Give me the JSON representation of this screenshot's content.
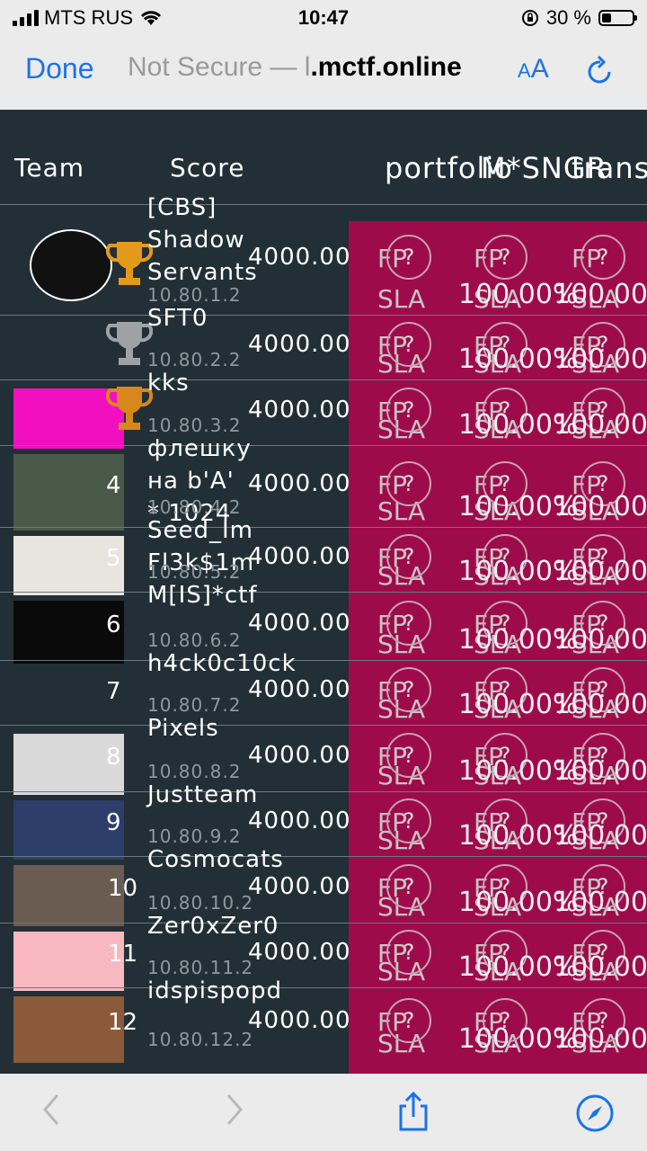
{
  "status": {
    "carrier": "MTS RUS",
    "time": "10:47",
    "battery": "30 %",
    "battery_level": 0.3
  },
  "browser": {
    "done": "Done",
    "not_secure": "Not Secure —",
    "domain_dim": "l",
    "domain": ".mctf.online",
    "text_size": "AA"
  },
  "header": {
    "team": "Team",
    "score": "Score",
    "svc1": "portfolio",
    "svc2": "M*SNGR",
    "svc3": "trans"
  },
  "labels": {
    "sla": "SLA",
    "fp": "FP",
    "pct": "100.00%",
    "q": "?"
  },
  "teams": [
    {
      "rank": "1",
      "name": "[CBS]\nShadow\nServants",
      "ip": "10.80.1.2",
      "score": "4000.00",
      "trophy": "gold",
      "logo": "shadow-servants-logo",
      "logo_color": "#ffffff"
    },
    {
      "rank": "2",
      "name": "SFT0",
      "ip": "10.80.2.2",
      "score": "4000.00",
      "trophy": "silver",
      "logo": "sft0-logo",
      "logo_color": "#232f36"
    },
    {
      "rank": "3",
      "name": "kks",
      "ip": "10.80.3.2",
      "score": "4000.00",
      "trophy": "bronze",
      "logo": "kks-logo",
      "logo_color": "#f20fc1"
    },
    {
      "rank": "4",
      "name": "флешку\nна b'A'\n* 1024",
      "ip": "10.80.4.2",
      "score": "4000.00",
      "trophy": "",
      "logo": "grenade-logo",
      "logo_color": "#4a5a48"
    },
    {
      "rank": "5",
      "name": "Seed_Im\nFl3k$1m",
      "ip": "10.80.5.2",
      "score": "4000.00",
      "trophy": "",
      "logo": "pepe-logo",
      "logo_color": "#e8e4de"
    },
    {
      "rank": "6",
      "name": "M[IS]*ctf",
      "ip": "10.80.6.2",
      "score": "4000.00",
      "trophy": "",
      "logo": "mis-ctf-logo",
      "logo_color": "#0a0a0a"
    },
    {
      "rank": "7",
      "name": "h4ck0c10ck",
      "ip": "10.80.7.2",
      "score": "4000.00",
      "trophy": "",
      "logo": "alarm-clock-logo",
      "logo_color": "#232f36"
    },
    {
      "rank": "8",
      "name": "Pixels",
      "ip": "10.80.8.2",
      "score": "4000.00",
      "trophy": "",
      "logo": "toaster-logo",
      "logo_color": "#d9d9d9"
    },
    {
      "rank": "9",
      "name": "Justteam",
      "ip": "10.80.9.2",
      "score": "4000.00",
      "trophy": "",
      "logo": "just-team-logo",
      "logo_color": "#2d3e6b"
    },
    {
      "rank": "10",
      "name": "Cosmocats",
      "ip": "10.80.10.2",
      "score": "4000.00",
      "trophy": "",
      "logo": "cat-logo",
      "logo_color": "#6a5c50"
    },
    {
      "rank": "11",
      "name": "Zer0xZer0",
      "ip": "10.80.11.2",
      "score": "4000.00",
      "trophy": "",
      "logo": "anime-eyes-logo",
      "logo_color": "#f7b8bf"
    },
    {
      "rank": "12",
      "name": "idspispopd",
      "ip": "10.80.12.2",
      "score": "4000.00",
      "trophy": "",
      "logo": "doomguy-logo",
      "logo_color": "#8a5a3a"
    }
  ],
  "colors": {
    "accent": "#1a73e8",
    "service_bg": "#9e0b4b",
    "page_bg": "#232f36"
  }
}
